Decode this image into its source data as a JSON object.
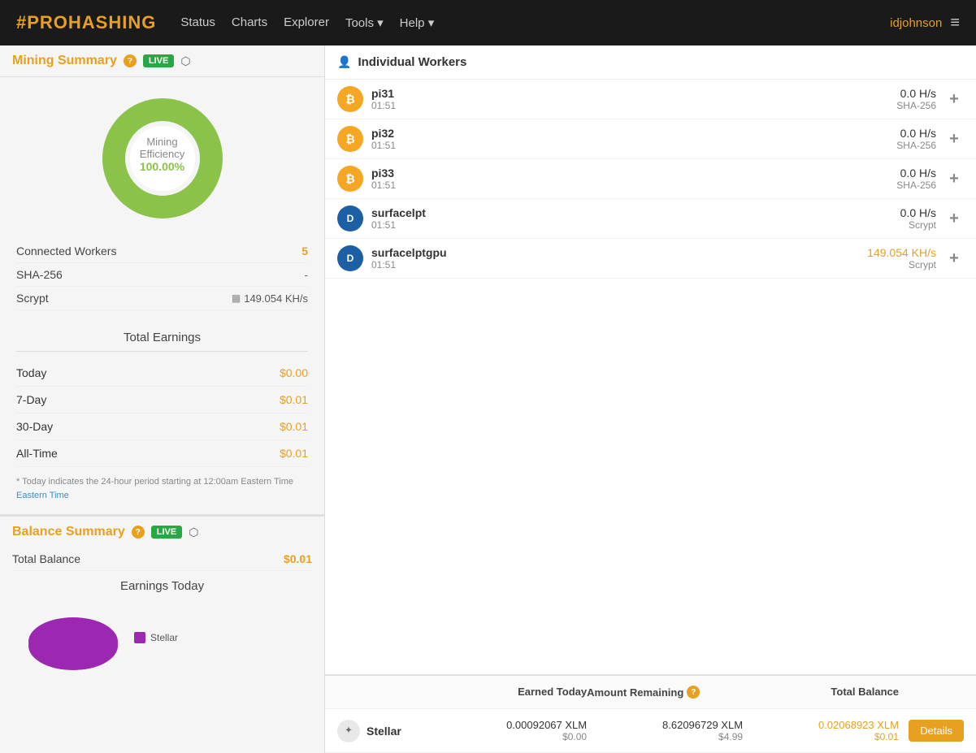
{
  "navbar": {
    "logo": "#PROHASHING",
    "links": [
      "Status",
      "Charts",
      "Explorer",
      "Tools",
      "Help"
    ],
    "user": "idjohnson"
  },
  "mining_summary": {
    "title": "Mining Summary",
    "live_badge": "LIVE",
    "efficiency_label": "Mining Efficiency",
    "efficiency_value": "100.00%",
    "connected_workers_label": "Connected Workers",
    "connected_workers_value": "5",
    "sha256_label": "SHA-256",
    "sha256_value": "-",
    "scrypt_label": "Scrypt",
    "scrypt_value": "149.054 KH/s",
    "total_earnings_title": "Total Earnings",
    "earnings": [
      {
        "label": "Today",
        "value": "$0.00"
      },
      {
        "label": "7-Day",
        "value": "$0.01"
      },
      {
        "label": "30-Day",
        "value": "$0.01"
      },
      {
        "label": "All-Time",
        "value": "$0.01"
      }
    ],
    "note": "* Today indicates the 24-hour period starting at 12:00am Eastern Time"
  },
  "balance_summary": {
    "title": "Balance Summary",
    "total_balance_label": "Total Balance",
    "total_balance_value": "$0.01",
    "earnings_today_title": "Earnings Today",
    "legend": [
      {
        "color": "#9c27b0",
        "label": "Stellar"
      }
    ]
  },
  "workers": {
    "title": "Individual Workers",
    "items": [
      {
        "name": "pi31",
        "time": "01:51",
        "hash": "0.0 H/s",
        "algo": "SHA-256",
        "coin_type": "bitcoin",
        "hash_orange": false
      },
      {
        "name": "pi32",
        "time": "01:51",
        "hash": "0.0 H/s",
        "algo": "SHA-256",
        "coin_type": "bitcoin",
        "hash_orange": false
      },
      {
        "name": "pi33",
        "time": "01:51",
        "hash": "0.0 H/s",
        "algo": "SHA-256",
        "coin_type": "bitcoin",
        "hash_orange": false
      },
      {
        "name": "surfacelpt",
        "time": "01:51",
        "hash": "0.0 H/s",
        "algo": "Scrypt",
        "coin_type": "dash",
        "hash_orange": false
      },
      {
        "name": "surfacelptgpu",
        "time": "01:51",
        "hash": "149.054 KH/s",
        "algo": "Scrypt",
        "coin_type": "dash",
        "hash_orange": true
      }
    ]
  },
  "balance_table": {
    "headers": [
      "",
      "Earned Today",
      "Amount Remaining",
      "Total Balance"
    ],
    "rows": [
      {
        "currency": "Stellar",
        "currency_short": "XLM",
        "earned_xlm": "0.00092067 XLM",
        "earned_usd": "$0.00",
        "remaining_xlm": "8.62096729 XLM",
        "remaining_usd": "$4.99",
        "total_xlm": "0.02068923 XLM",
        "total_usd": "$0.01"
      }
    ],
    "details_label": "Details"
  }
}
